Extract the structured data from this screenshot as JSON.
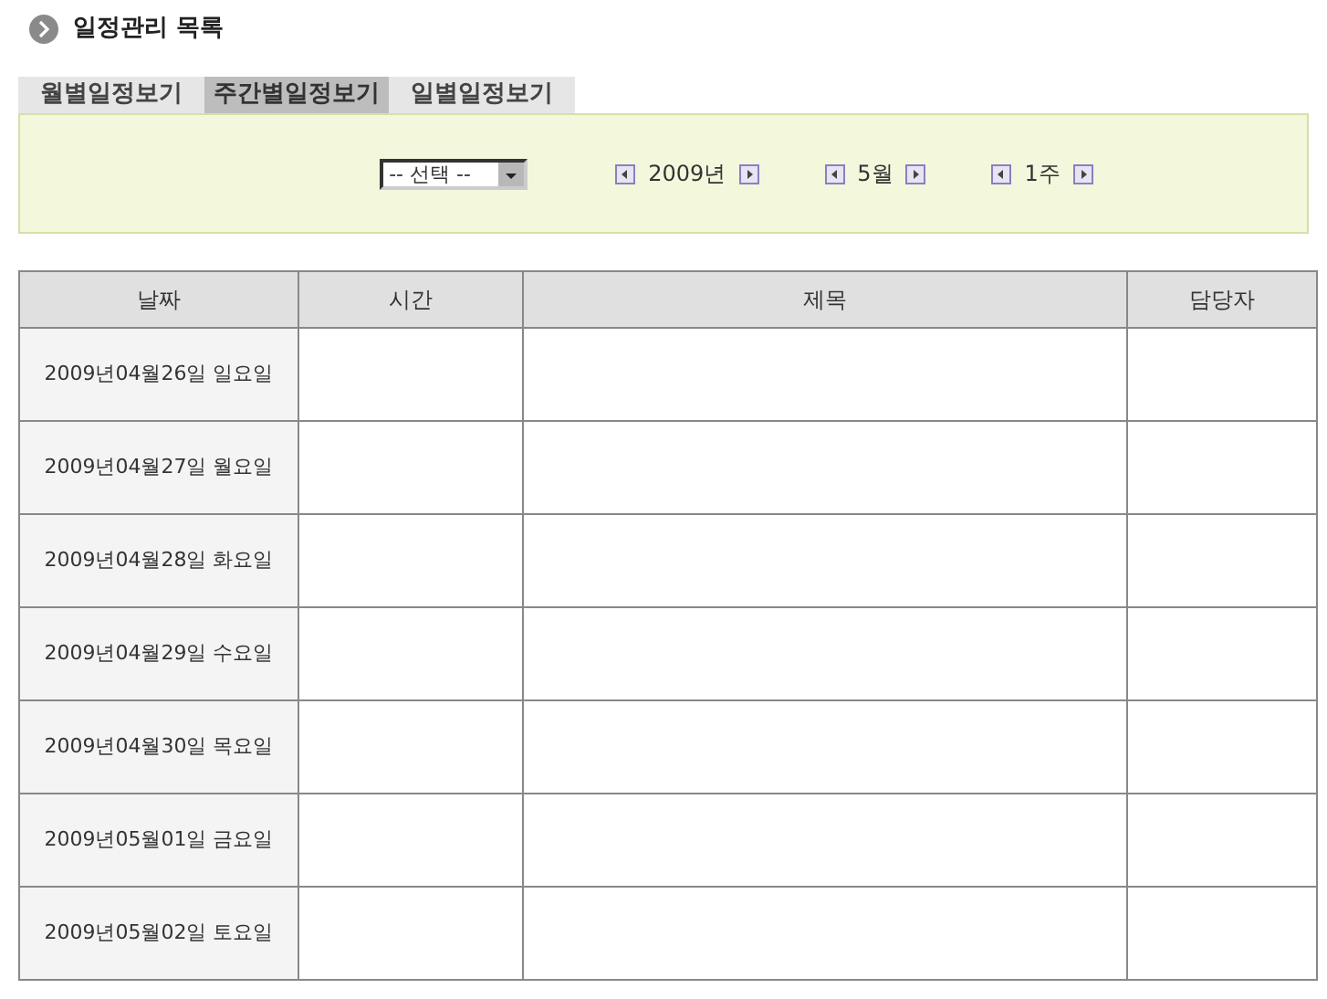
{
  "title": "일정관리 목록",
  "tabs": [
    {
      "label": "월별일정보기",
      "selected": false
    },
    {
      "label": "주간별일정보기",
      "selected": true
    },
    {
      "label": "일별일정보기",
      "selected": false
    }
  ],
  "filter": {
    "select": "-- 선택 --",
    "year": "2009년",
    "month": "5월",
    "week": "1주"
  },
  "table": {
    "columns": [
      "날짜",
      "시간",
      "제목",
      "담당자"
    ],
    "rows": [
      {
        "date": "2009년04월26일 일요일"
      },
      {
        "date": "2009년04월27일 월요일"
      },
      {
        "date": "2009년04월28일 화요일"
      },
      {
        "date": "2009년04월29일 수요일"
      },
      {
        "date": "2009년04월30일 목요일"
      },
      {
        "date": "2009년05월01일 금요일"
      },
      {
        "date": "2009년05월02일 토요일"
      }
    ]
  }
}
